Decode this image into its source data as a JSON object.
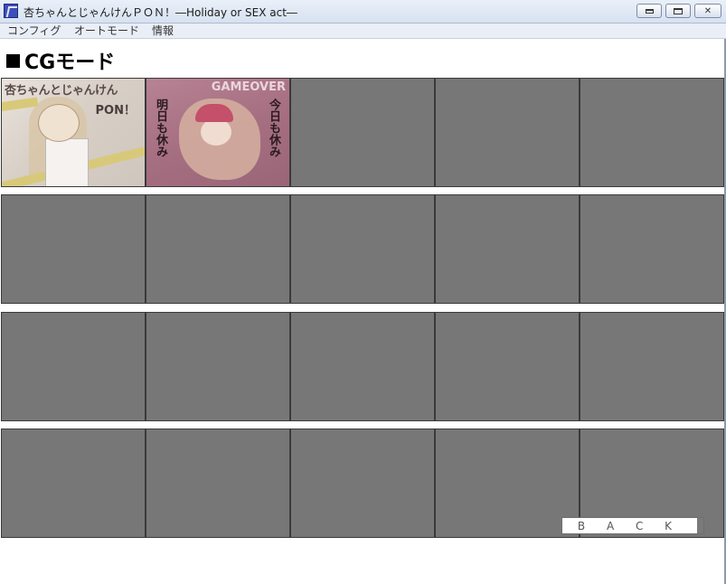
{
  "window": {
    "title": "杏ちゃんとじゃんけんＰＯＮ！―Holiday or SEX act―",
    "icon": "app-icon",
    "controls": [
      "minimize-icon",
      "restore-icon",
      "close-icon"
    ]
  },
  "menu": {
    "items": [
      {
        "label": "コンフィグ"
      },
      {
        "label": "オートモード"
      },
      {
        "label": "情報"
      }
    ]
  },
  "page": {
    "title": "CGモード"
  },
  "gallery": {
    "rows": 4,
    "columns": 5,
    "thumbnails": [
      {
        "logo": "杏ちゃんとじゃんけん",
        "sub": "PON！"
      },
      {
        "header": "GAMEOVER",
        "left_text": "明日も休み",
        "right_text": "今日も休み"
      }
    ],
    "locked_color": "#777777"
  },
  "back_button": {
    "label": "B A C K"
  }
}
